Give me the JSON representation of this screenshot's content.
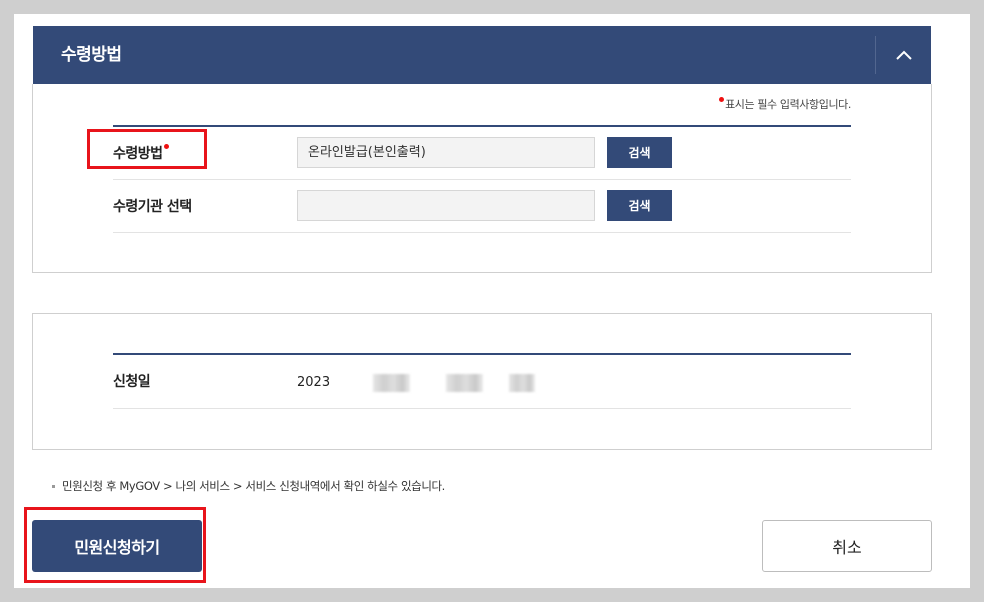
{
  "panel": {
    "title": "수령방법",
    "toggle_icon": "chevron-up-icon"
  },
  "required_note": "표시는 필수 입력사항입니다.",
  "form": {
    "rows": [
      {
        "label": "수령방법",
        "required": true,
        "value": "온라인발급(본인출력)",
        "button": "검색"
      },
      {
        "label": "수령기관 선택",
        "required": false,
        "value": "",
        "button": "검색"
      }
    ]
  },
  "application": {
    "date_label": "신청일",
    "year": "2023"
  },
  "notice": "민원신청 후 MyGOV > 나의 서비스 > 서비스 신청내역에서 확인 하실수 있습니다.",
  "buttons": {
    "submit": "민원신청하기",
    "cancel": "취소"
  },
  "colors": {
    "primary": "#334a78",
    "required_dot": "#e11111",
    "highlight_box": "#e8141b"
  }
}
